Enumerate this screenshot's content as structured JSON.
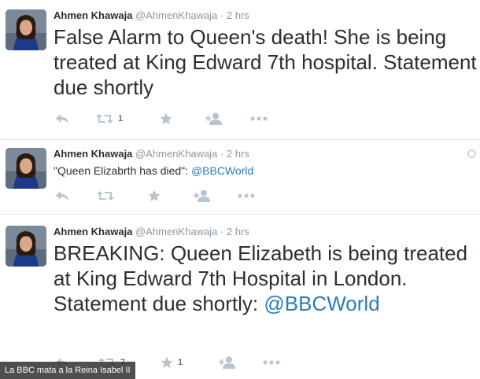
{
  "tweets": [
    {
      "fullname": "Ahmen Khawaja",
      "username": "@AhmenKhawaja",
      "separator": "·",
      "time": "2 hrs",
      "text": "False Alarm to Queen's death! She is being treated at King Edward 7th hospital. Statement due shortly",
      "retweet_count": "1",
      "favorite_count": ""
    },
    {
      "fullname": "Ahmen Khawaja",
      "username": "@AhmenKhawaja",
      "separator": "·",
      "time": "2 hrs",
      "text_before": "\"Queen Elizabrth has died\": ",
      "mention": "@BBCWorld",
      "retweet_count": "",
      "favorite_count": ""
    },
    {
      "fullname": "Ahmen Khawaja",
      "username": "@AhmenKhawaja",
      "separator": "·",
      "time": "2 hrs",
      "text_before": "BREAKING: Queen Elizabeth is being treated at King Edward 7th Hospital in London. Statement due shortly:",
      "mention": "@BBCWorld",
      "retweet_count": "7",
      "favorite_count": "1"
    }
  ],
  "icons": [
    "reply-icon",
    "retweet-icon",
    "favorite-star-icon",
    "follow-icon",
    "more-icon"
  ],
  "caption": "La BBC mata a la Reina Isabel II",
  "colors": {
    "text": "#292f33",
    "muted": "#8899a6",
    "link": "#2b7bb9",
    "action_icon": "#b8c5cf",
    "divider": "#e1e8ed"
  }
}
